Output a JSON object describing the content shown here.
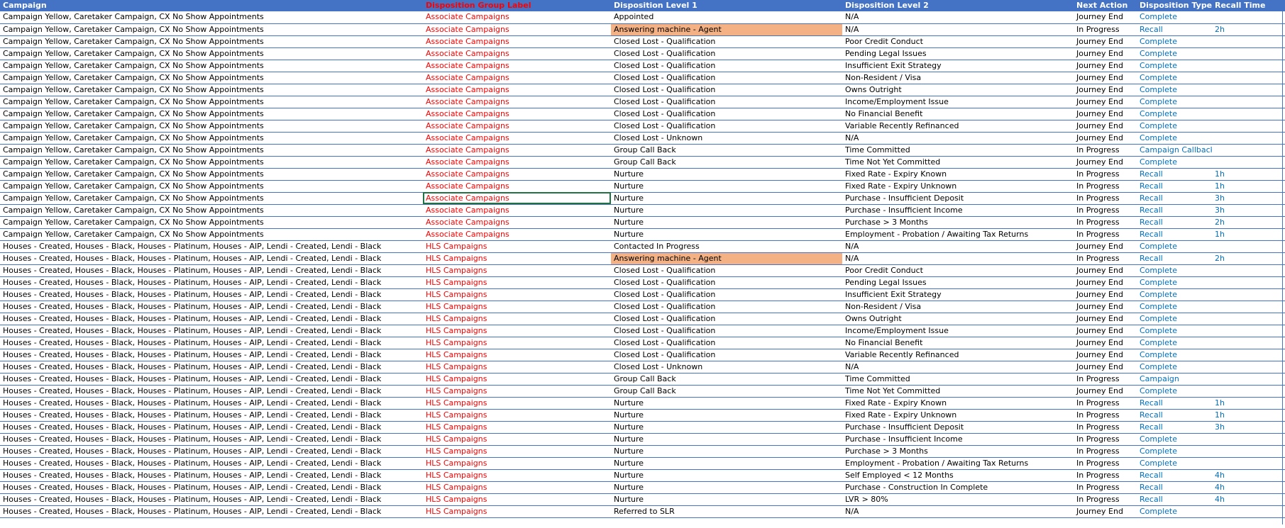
{
  "sheet": {
    "headers": [
      "Campaign",
      "Disposition Group Label",
      "Disposition Level 1",
      "Disposition Level 2",
      "Next Action",
      "Disposition Type",
      "Recall Time"
    ],
    "accent_colors": {
      "header_bg": "#4472c4",
      "group_text": "#ff0000",
      "type_text": "#0070c0",
      "highlight": "#f4b183",
      "selection": "#217346"
    },
    "selected_cell": {
      "row": 16,
      "column": "Disposition Group Label"
    },
    "highlighted_cells": [
      {
        "row": 2,
        "column": "Disposition Level 1"
      },
      {
        "row": 21,
        "column": "Disposition Level 1"
      }
    ],
    "rows": [
      [
        "Campaign Yellow, Caretaker Campaign, CX No Show Appointments",
        "Associate Campaigns",
        "Appointed",
        "N/A",
        "Journey End",
        "Complete",
        ""
      ],
      [
        "Campaign Yellow, Caretaker Campaign, CX No Show Appointments",
        "Associate Campaigns",
        "Answering machine - Agent",
        "N/A",
        "In Progress",
        "Recall",
        "2h"
      ],
      [
        "Campaign Yellow, Caretaker Campaign, CX No Show Appointments",
        "Associate Campaigns",
        "Closed Lost - Qualification",
        "Poor Credit Conduct",
        "Journey End",
        "Complete",
        ""
      ],
      [
        "Campaign Yellow, Caretaker Campaign, CX No Show Appointments",
        "Associate Campaigns",
        "Closed Lost - Qualification",
        "Pending Legal Issues",
        "Journey End",
        "Complete",
        ""
      ],
      [
        "Campaign Yellow, Caretaker Campaign, CX No Show Appointments",
        "Associate Campaigns",
        "Closed Lost - Qualification",
        "Insufficient Exit Strategy",
        "Journey End",
        "Complete",
        ""
      ],
      [
        "Campaign Yellow, Caretaker Campaign, CX No Show Appointments",
        "Associate Campaigns",
        "Closed Lost - Qualification",
        "Non-Resident / Visa",
        "Journey End",
        "Complete",
        ""
      ],
      [
        "Campaign Yellow, Caretaker Campaign, CX No Show Appointments",
        "Associate Campaigns",
        "Closed Lost - Qualification",
        "Owns Outright",
        "Journey End",
        "Complete",
        ""
      ],
      [
        "Campaign Yellow, Caretaker Campaign, CX No Show Appointments",
        "Associate Campaigns",
        "Closed Lost - Qualification",
        "Income/Employment Issue",
        "Journey End",
        "Complete",
        ""
      ],
      [
        "Campaign Yellow, Caretaker Campaign, CX No Show Appointments",
        "Associate Campaigns",
        "Closed Lost - Qualification",
        "No Financial Benefit",
        "Journey End",
        "Complete",
        ""
      ],
      [
        "Campaign Yellow, Caretaker Campaign, CX No Show Appointments",
        "Associate Campaigns",
        "Closed Lost - Qualification",
        "Variable Recently Refinanced",
        "Journey End",
        "Complete",
        ""
      ],
      [
        "Campaign Yellow, Caretaker Campaign, CX No Show Appointments",
        "Associate Campaigns",
        "Closed Lost - Unknown",
        "N/A",
        "Journey End",
        "Complete",
        ""
      ],
      [
        "Campaign Yellow, Caretaker Campaign, CX No Show Appointments",
        "Associate Campaigns",
        "Group Call Back",
        "Time Committed",
        "In Progress",
        "Campaign Callback",
        ""
      ],
      [
        "Campaign Yellow, Caretaker Campaign, CX No Show Appointments",
        "Associate Campaigns",
        "Group Call Back",
        "Time Not Yet Committed",
        "Journey End",
        "Complete",
        ""
      ],
      [
        "Campaign Yellow, Caretaker Campaign, CX No Show Appointments",
        "Associate Campaigns",
        "Nurture",
        "Fixed Rate - Expiry Known",
        "In Progress",
        "Recall",
        "1h"
      ],
      [
        "Campaign Yellow, Caretaker Campaign, CX No Show Appointments",
        "Associate Campaigns",
        "Nurture",
        "Fixed Rate - Expiry Unknown",
        "In Progress",
        "Recall",
        "1h"
      ],
      [
        "Campaign Yellow, Caretaker Campaign, CX No Show Appointments",
        "Associate Campaigns",
        "Nurture",
        "Purchase - Insufficient Deposit",
        "In Progress",
        "Recall",
        "3h"
      ],
      [
        "Campaign Yellow, Caretaker Campaign, CX No Show Appointments",
        "Associate Campaigns",
        "Nurture",
        "Purchase - Insufficient Income",
        "In Progress",
        "Recall",
        "3h"
      ],
      [
        "Campaign Yellow, Caretaker Campaign, CX No Show Appointments",
        "Associate Campaigns",
        "Nurture",
        "Purchase > 3 Months",
        "In Progress",
        "Recall",
        "2h"
      ],
      [
        "Campaign Yellow, Caretaker Campaign, CX No Show Appointments",
        "Associate Campaigns",
        "Nurture",
        "Employment - Probation / Awaiting Tax Returns",
        "In Progress",
        "Recall",
        "1h"
      ],
      [
        "Houses - Created, Houses - Black, Houses - Platinum, Houses - AIP, Lendi - Created, Lendi - Black",
        "HLS Campaigns",
        "Contacted In Progress",
        "N/A",
        "Journey End",
        "Complete",
        ""
      ],
      [
        "Houses - Created, Houses - Black, Houses - Platinum, Houses - AIP, Lendi - Created, Lendi - Black",
        "HLS Campaigns",
        "Answering machine - Agent",
        "N/A",
        "In Progress",
        "Recall",
        "2h"
      ],
      [
        "Houses - Created, Houses - Black, Houses - Platinum, Houses - AIP, Lendi - Created, Lendi - Black",
        "HLS Campaigns",
        "Closed Lost - Qualification",
        "Poor Credit Conduct",
        "Journey End",
        "Complete",
        ""
      ],
      [
        "Houses - Created, Houses - Black, Houses - Platinum, Houses - AIP, Lendi - Created, Lendi - Black",
        "HLS Campaigns",
        "Closed Lost - Qualification",
        "Pending Legal Issues",
        "Journey End",
        "Complete",
        ""
      ],
      [
        "Houses - Created, Houses - Black, Houses - Platinum, Houses - AIP, Lendi - Created, Lendi - Black",
        "HLS Campaigns",
        "Closed Lost - Qualification",
        "Insufficient Exit Strategy",
        "Journey End",
        "Complete",
        ""
      ],
      [
        "Houses - Created, Houses - Black, Houses - Platinum, Houses - AIP, Lendi - Created, Lendi - Black",
        "HLS Campaigns",
        "Closed Lost - Qualification",
        "Non-Resident / Visa",
        "Journey End",
        "Complete",
        ""
      ],
      [
        "Houses - Created, Houses - Black, Houses - Platinum, Houses - AIP, Lendi - Created, Lendi - Black",
        "HLS Campaigns",
        "Closed Lost - Qualification",
        "Owns Outright",
        "Journey End",
        "Complete",
        ""
      ],
      [
        "Houses - Created, Houses - Black, Houses - Platinum, Houses - AIP, Lendi - Created, Lendi - Black",
        "HLS Campaigns",
        "Closed Lost - Qualification",
        "Income/Employment Issue",
        "Journey End",
        "Complete",
        ""
      ],
      [
        "Houses - Created, Houses - Black, Houses - Platinum, Houses - AIP, Lendi - Created, Lendi - Black",
        "HLS Campaigns",
        "Closed Lost - Qualification",
        "No Financial Benefit",
        "Journey End",
        "Complete",
        ""
      ],
      [
        "Houses - Created, Houses - Black, Houses - Platinum, Houses - AIP, Lendi - Created, Lendi - Black",
        "HLS Campaigns",
        "Closed Lost - Qualification",
        "Variable Recently Refinanced",
        "Journey End",
        "Complete",
        ""
      ],
      [
        "Houses - Created, Houses - Black, Houses - Platinum, Houses - AIP, Lendi - Created, Lendi - Black",
        "HLS Campaigns",
        "Closed Lost - Unknown",
        "N/A",
        "Journey End",
        "Complete",
        ""
      ],
      [
        "Houses - Created, Houses - Black, Houses - Platinum, Houses - AIP, Lendi - Created, Lendi - Black",
        "HLS Campaigns",
        "Group Call Back",
        "Time Committed",
        "In Progress",
        "Campaign",
        ""
      ],
      [
        "Houses - Created, Houses - Black, Houses - Platinum, Houses - AIP, Lendi - Created, Lendi - Black",
        "HLS Campaigns",
        "Group Call Back",
        "Time Not Yet Committed",
        "Journey End",
        "Complete",
        ""
      ],
      [
        "Houses - Created, Houses - Black, Houses - Platinum, Houses - AIP, Lendi - Created, Lendi - Black",
        "HLS Campaigns",
        "Nurture",
        "Fixed Rate - Expiry Known",
        "In Progress",
        "Recall",
        "1h"
      ],
      [
        "Houses - Created, Houses - Black, Houses - Platinum, Houses - AIP, Lendi - Created, Lendi - Black",
        "HLS Campaigns",
        "Nurture",
        "Fixed Rate - Expiry Unknown",
        "In Progress",
        "Recall",
        "1h"
      ],
      [
        "Houses - Created, Houses - Black, Houses - Platinum, Houses - AIP, Lendi - Created, Lendi - Black",
        "HLS Campaigns",
        "Nurture",
        "Purchase - Insufficient Deposit",
        "In Progress",
        "Recall",
        "3h"
      ],
      [
        "Houses - Created, Houses - Black, Houses - Platinum, Houses - AIP, Lendi - Created, Lendi - Black",
        "HLS Campaigns",
        "Nurture",
        "Purchase - Insufficient Income",
        "In Progress",
        "Complete",
        ""
      ],
      [
        "Houses - Created, Houses - Black, Houses - Platinum, Houses - AIP, Lendi - Created, Lendi - Black",
        "HLS Campaigns",
        "Nurture",
        "Purchase > 3 Months",
        "In Progress",
        "Complete",
        ""
      ],
      [
        "Houses - Created, Houses - Black, Houses - Platinum, Houses - AIP, Lendi - Created, Lendi - Black",
        "HLS Campaigns",
        "Nurture",
        "Employment - Probation / Awaiting Tax Returns",
        "In Progress",
        "Complete",
        ""
      ],
      [
        "Houses - Created, Houses - Black, Houses - Platinum, Houses - AIP, Lendi - Created, Lendi - Black",
        "HLS Campaigns",
        "Nurture",
        "Self Employed < 12 Months",
        "In Progress",
        "Recall",
        "4h"
      ],
      [
        "Houses - Created, Houses - Black, Houses - Platinum, Houses - AIP, Lendi - Created, Lendi - Black",
        "HLS Campaigns",
        "Nurture",
        "Purchase - Construction In Complete",
        "In Progress",
        "Recall",
        "4h"
      ],
      [
        "Houses - Created, Houses - Black, Houses - Platinum, Houses - AIP, Lendi - Created, Lendi - Black",
        "HLS Campaigns",
        "Nurture",
        "LVR > 80%",
        "In Progress",
        "Recall",
        "4h"
      ],
      [
        "Houses - Created, Houses - Black, Houses - Platinum, Houses - AIP, Lendi - Created, Lendi - Black",
        "HLS Campaigns",
        "Referred to SLR",
        "N/A",
        "Journey End",
        "Complete",
        ""
      ]
    ]
  }
}
